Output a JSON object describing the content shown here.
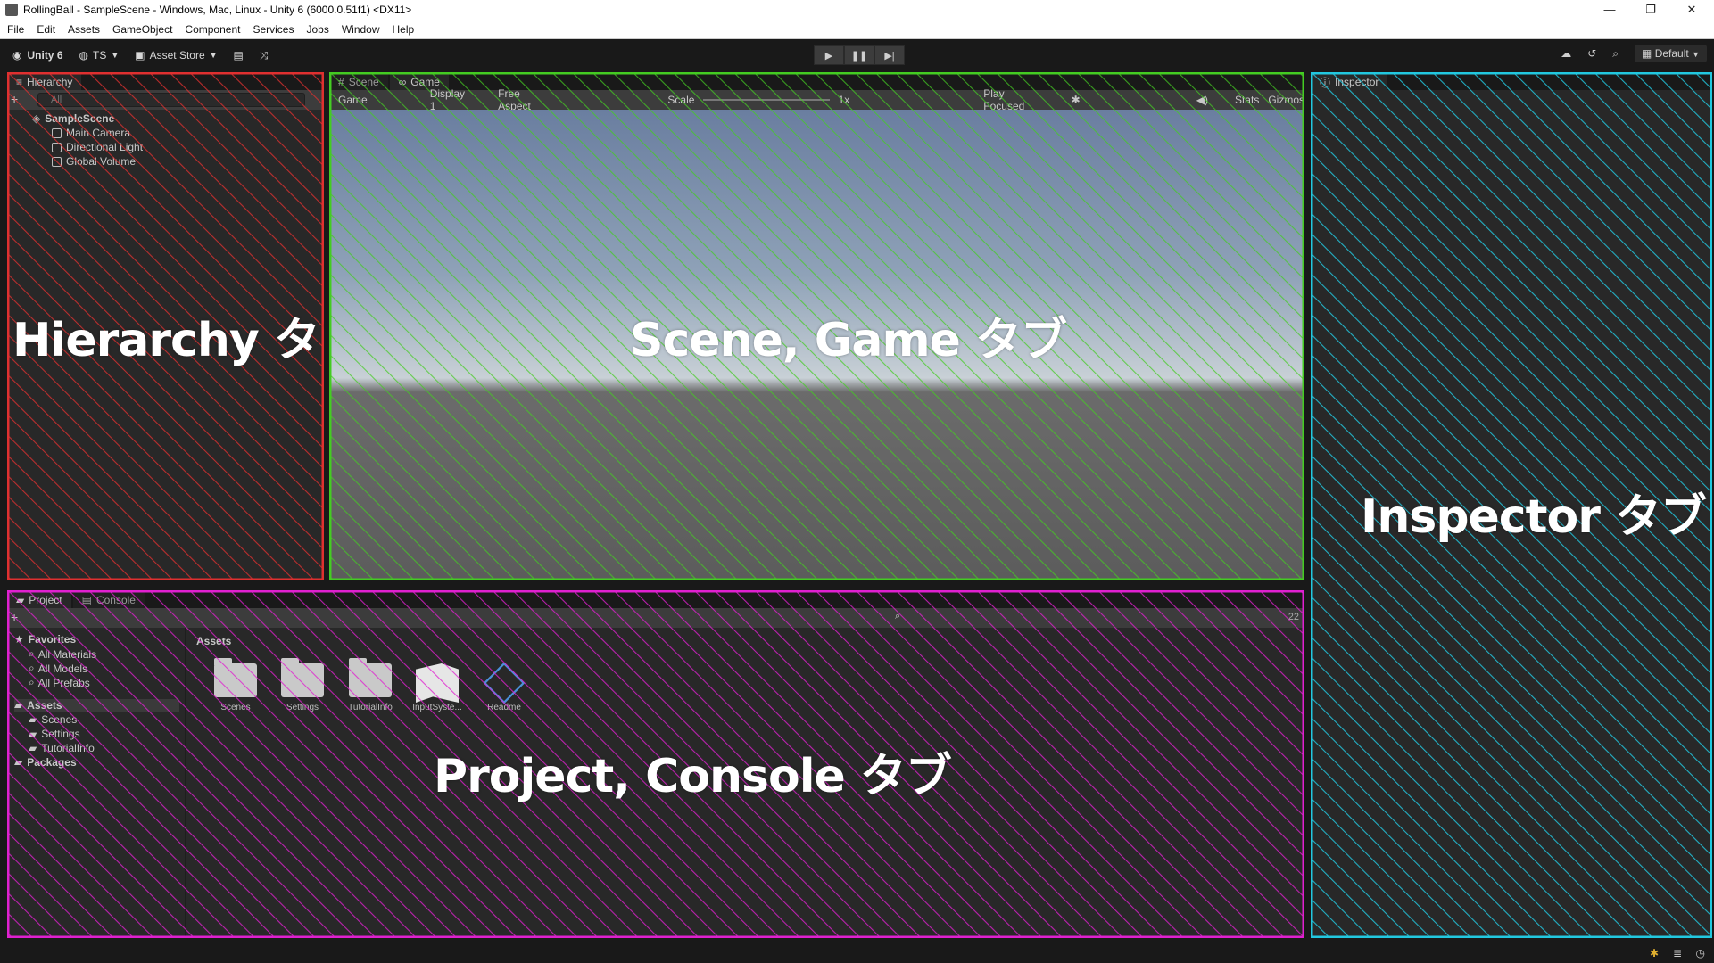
{
  "window": {
    "title": "RollingBall - SampleScene - Windows, Mac, Linux - Unity 6 (6000.0.51f1) <DX11>",
    "minimize": "—",
    "maximize": "❐",
    "close": "✕"
  },
  "menu": [
    "File",
    "Edit",
    "Assets",
    "GameObject",
    "Component",
    "Services",
    "Jobs",
    "Window",
    "Help"
  ],
  "toolbar": {
    "unity_label": "Unity 6",
    "account_label": "TS",
    "asset_store_label": "Asset Store",
    "layout_label": "Default"
  },
  "hierarchy": {
    "tab": "Hierarchy",
    "search_placeholder": "All",
    "scene": "SampleScene",
    "items": [
      "Main Camera",
      "Directional Light",
      "Global Volume"
    ],
    "overlay": "Hierarchy タブ"
  },
  "sceneGame": {
    "tabs": [
      "Scene",
      "Game"
    ],
    "toolbar": {
      "mode": "Game",
      "display": "Display 1",
      "aspect": "Free Aspect",
      "scale_label": "Scale",
      "scale_value": "1x",
      "play_mode": "Play Focused",
      "stats": "Stats",
      "gizmos": "Gizmos"
    },
    "overlay": "Scene, Game タブ"
  },
  "inspector": {
    "tab": "Inspector",
    "overlay": "Inspector タブ"
  },
  "project": {
    "tabs": [
      "Project",
      "Console"
    ],
    "favorites": "Favorites",
    "favorite_items": [
      "All Materials",
      "All Models",
      "All Prefabs"
    ],
    "assets_root": "Assets",
    "asset_folders": [
      "Scenes",
      "Settings",
      "TutorialInfo"
    ],
    "packages": "Packages",
    "assets_header": "Assets",
    "grid_items": [
      "Scenes",
      "Settings",
      "TutorialInfo",
      "InputSyste...",
      "Readme"
    ],
    "count": "22",
    "overlay": "Project, Console タブ"
  },
  "colors": {
    "hierarchy_outline": "#e03030",
    "scene_outline": "#44cc22",
    "inspector_outline": "#22c8e0",
    "project_outline": "#e020d0"
  }
}
